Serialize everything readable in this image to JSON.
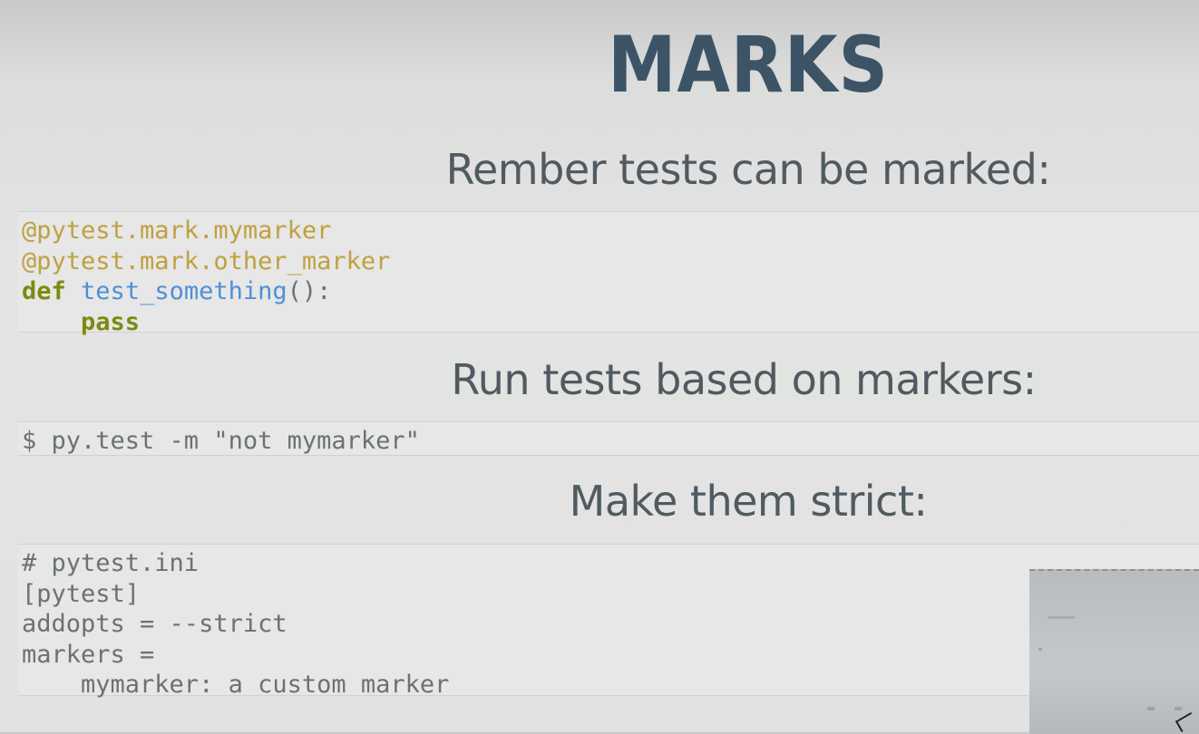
{
  "slide": {
    "title": "MARKS",
    "heading1": "Rember tests can be marked:",
    "heading2": "Run tests based on markers:",
    "heading3": "Make them strict:"
  },
  "code1": {
    "line1": "@pytest.mark.mymarker",
    "line2": "@pytest.mark.other_marker",
    "def_kw": "def",
    "fn_name": "test_something",
    "fn_rest": "():",
    "indent": "    ",
    "pass_kw": "pass"
  },
  "code2": {
    "line1": "$ py.test -m \"not mymarker\""
  },
  "code3": {
    "line1": "# pytest.ini",
    "line2": "[pytest]",
    "line3": "addopts = --strict",
    "line4": "markers =",
    "line5": "    mymarker: a custom marker"
  },
  "colors": {
    "title": "#3c5466",
    "decorator": "#c0a040",
    "keyword": "#7d8a10",
    "function": "#4f8fd8",
    "code_text": "#6b7176"
  }
}
